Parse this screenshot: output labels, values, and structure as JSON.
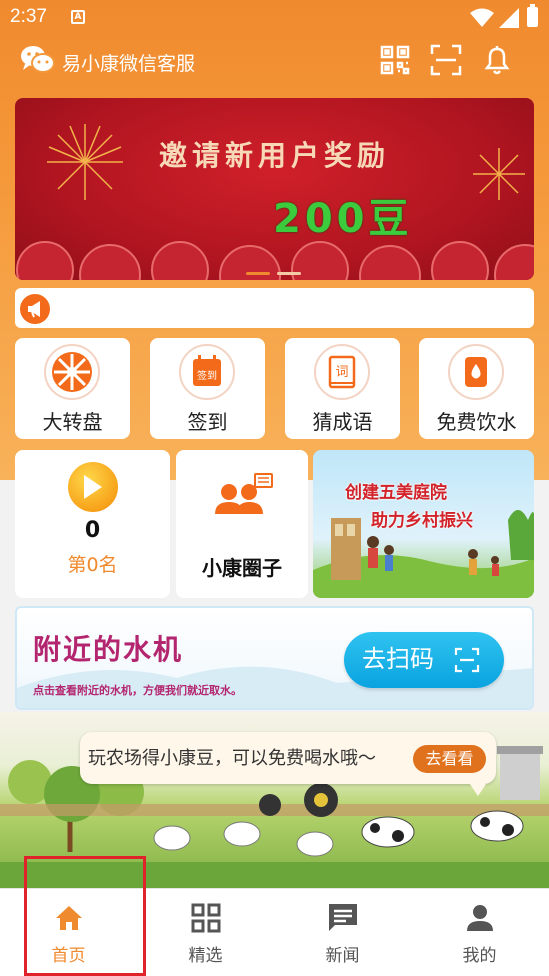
{
  "status_bar": {
    "time": "2:37",
    "notification_badge": "A"
  },
  "header": {
    "cs_label": "易小康微信客服",
    "icons": [
      "wechat-icon",
      "qr-code-icon",
      "scan-icon",
      "bell-icon"
    ]
  },
  "banner": {
    "title": "邀请新用户奖励",
    "reward": "200豆",
    "page_count": 2,
    "active_page": 1
  },
  "quick_actions": [
    {
      "label": "大转盘",
      "icon": "wheel-icon"
    },
    {
      "label": "签到",
      "icon": "calendar-checkin-icon",
      "icon_text": "签到"
    },
    {
      "label": "猜成语",
      "icon": "idiom-book-icon",
      "icon_text": "词"
    },
    {
      "label": "免费饮水",
      "icon": "water-drop-icon"
    }
  ],
  "points_card": {
    "value": "0",
    "rank": "第0名"
  },
  "community_card": {
    "label": "小康圈子"
  },
  "village_card": {
    "line1": "创建五美庭院",
    "line2": "助力乡村振兴"
  },
  "water_banner": {
    "title": "附近的水机",
    "subtitle": "点击查看附近的水机，方便我们就近取水。",
    "button": "去扫码"
  },
  "farm": {
    "message": "玩农场得小康豆，可以免费喝水哦～",
    "button": "去看看"
  },
  "bottom_nav": [
    {
      "label": "首页",
      "icon": "home-icon",
      "active": true
    },
    {
      "label": "精选",
      "icon": "grid-icon",
      "active": false
    },
    {
      "label": "新闻",
      "icon": "news-icon",
      "active": false
    },
    {
      "label": "我的",
      "icon": "profile-icon",
      "active": false
    }
  ],
  "colors": {
    "accent": "#f08a2e",
    "banner_red": "#b01520",
    "reward_green": "#3ccb3c",
    "water_title": "#b3256f",
    "scan_blue": "#0aa3e0",
    "highlight": "#e0222a"
  }
}
